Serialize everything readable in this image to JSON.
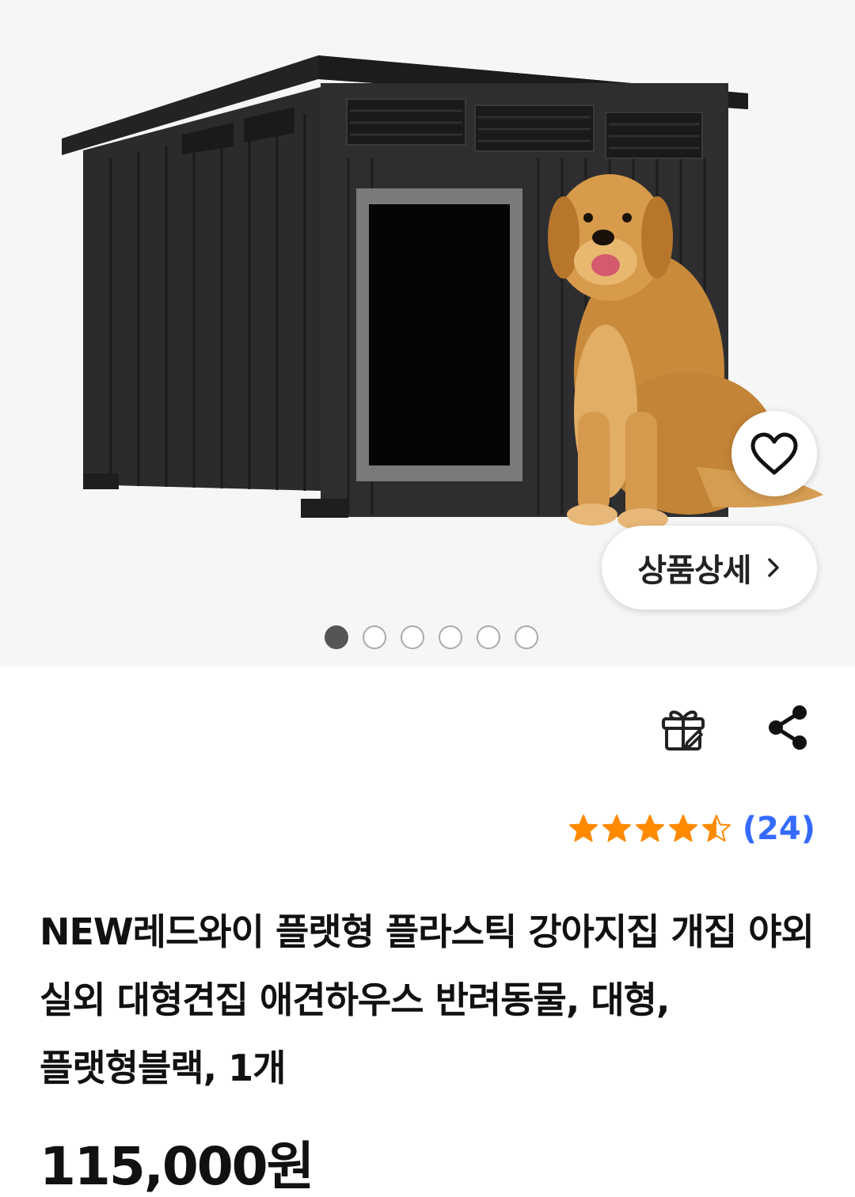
{
  "hero": {
    "image": "dog-house-with-golden-retriever",
    "carousel": {
      "total": 6,
      "active_index": 0
    },
    "wish_icon": "heart-icon",
    "detail_button_label": "상품상세",
    "detail_button_icon": "chevron-right-icon"
  },
  "actions": {
    "gift_icon": "gift-icon",
    "share_icon": "share-icon"
  },
  "rating": {
    "stars": 4.5,
    "max": 5,
    "count_label": "(24)",
    "star_color": "#ff8a00",
    "count_color": "#346aff"
  },
  "product": {
    "title": "NEW레드와이 플랫형 플라스틱 강아지집 개집 야외 실외 대형견집 애견하우스 반려동물, 대형, 플랫형블랙, 1개",
    "price": "115,000원"
  }
}
